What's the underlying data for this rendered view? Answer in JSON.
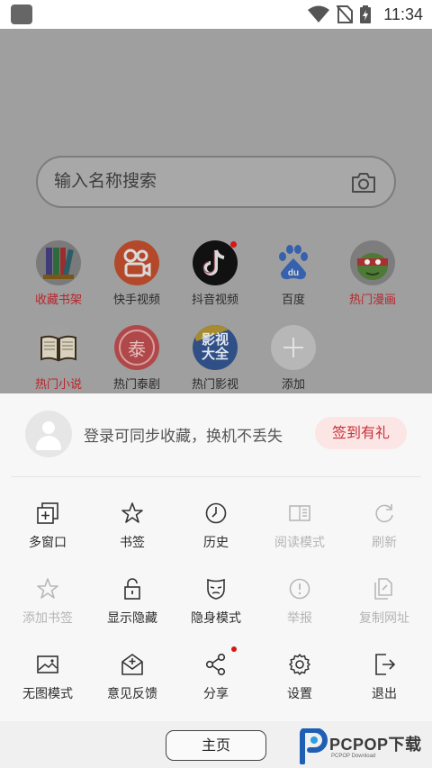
{
  "status_bar": {
    "time": "11:34"
  },
  "search": {
    "placeholder": "输入名称搜索"
  },
  "shortcuts": [
    {
      "label": "收藏书架",
      "icon": "bookshelf-icon",
      "label_color": "#b8242a"
    },
    {
      "label": "快手视频",
      "icon": "kuaishou-icon"
    },
    {
      "label": "抖音视频",
      "icon": "douyin-icon",
      "badge": true
    },
    {
      "label": "百度",
      "icon": "baidu-icon"
    },
    {
      "label": "热门漫画",
      "icon": "comic-icon",
      "label_color": "#b8242a"
    },
    {
      "label": "热门小说",
      "icon": "book-icon",
      "label_color": "#b8242a"
    },
    {
      "label": "热门泰剧",
      "icon": "thai-drama-icon",
      "glyph": "泰"
    },
    {
      "label": "热门影视",
      "icon": "movies-icon",
      "glyph": "影视大全"
    },
    {
      "label": "添加",
      "icon": "add-icon"
    }
  ],
  "login": {
    "text": "登录可同步收藏，换机不丢失",
    "checkin_label": "签到有礼"
  },
  "menu": [
    [
      {
        "label": "多窗口",
        "icon": "multi-window-icon",
        "enabled": true
      },
      {
        "label": "书签",
        "icon": "star-icon",
        "enabled": true
      },
      {
        "label": "历史",
        "icon": "clock-icon",
        "enabled": true
      },
      {
        "label": "阅读模式",
        "icon": "reading-mode-icon",
        "enabled": false
      },
      {
        "label": "刷新",
        "icon": "refresh-icon",
        "enabled": false
      }
    ],
    [
      {
        "label": "添加书签",
        "icon": "star-outline-icon",
        "enabled": false
      },
      {
        "label": "显示隐藏",
        "icon": "unlock-icon",
        "enabled": true
      },
      {
        "label": "隐身模式",
        "icon": "mask-icon",
        "enabled": true
      },
      {
        "label": "举报",
        "icon": "alert-icon",
        "enabled": false
      },
      {
        "label": "复制网址",
        "icon": "copy-link-icon",
        "enabled": false
      }
    ],
    [
      {
        "label": "无图模式",
        "icon": "image-icon",
        "enabled": true
      },
      {
        "label": "意见反馈",
        "icon": "feedback-icon",
        "enabled": true
      },
      {
        "label": "分享",
        "icon": "share-icon",
        "enabled": true,
        "badge": true
      },
      {
        "label": "设置",
        "icon": "gear-icon",
        "enabled": true
      },
      {
        "label": "退出",
        "icon": "exit-icon",
        "enabled": true
      }
    ]
  ],
  "bottom": {
    "home_label": "主页"
  },
  "watermark": {
    "text": "PCPOP下载",
    "sub": "PCPOP Download"
  },
  "colors": {
    "accent_red": "#c8333a",
    "backdrop": "#9f9f9f",
    "panel": "#f7f7f7"
  }
}
